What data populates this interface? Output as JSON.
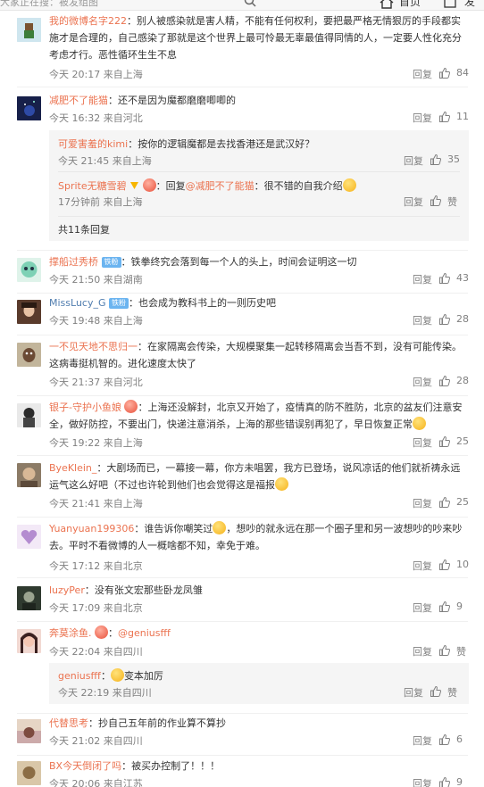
{
  "topbar": {
    "search_placeholder": "大家正在搜：被发组图",
    "home_label": "首页",
    "more_label": "发"
  },
  "reply_label": "回复",
  "comments": [
    {
      "user": "我的微博名字222",
      "text": "：别人被感染就是害人精，不能有任何权利，要把最严格无情狠厉的手段都实施才是合理的，自己感染了那就是这个世界上最可怜最无辜最值得同情的人，一定要人性化充分考虑才行。恶性循环生生不息",
      "time": "今天 20:17 来自上海",
      "likes": "84"
    },
    {
      "user": "减肥不了能猫",
      "text": "：还不是因为魔都磨磨唧唧的",
      "time": "今天 16:32 来自河北",
      "likes": "11",
      "replies": [
        {
          "user": "可爱害羞的kimi",
          "text": "：按你的逻辑魔都是去找香港还是武汉好？",
          "time": "今天 21:45 来自上海",
          "likes": "35"
        },
        {
          "user": "Sprite无糖雪碧",
          "text_prefix": "：回复",
          "mention": "@减肥不了能猫",
          "text": "：很不错的自我介绍",
          "time": "17分钟前 来自上海",
          "likes": "赞"
        }
      ],
      "more_replies": "共11条回复"
    },
    {
      "user": "撑船过秀桥",
      "badge": "铁粉",
      "text": "：铁拳终究会落到每一个人的头上，时间会证明这一切",
      "time": "今天 21:50 来自湖南",
      "likes": "43"
    },
    {
      "user": "MissLucy_G",
      "badge": "铁粉",
      "text": "：也会成为教科书上的一则历史吧",
      "time": "今天 19:48 来自上海",
      "likes": "28"
    },
    {
      "user": "一不见天地不思归一",
      "text": "：在家隔离会传染，大规模聚集一起转移隔离会当吾不到，没有可能传染。这病毒挺机智的。进化速度太快了",
      "time": "今天 21:37 来自河北",
      "likes": "28"
    },
    {
      "user": "银子-守护小鱼娘",
      "text": "：上海还没解封，北京又开始了，疫情真的防不胜防，北京的盆友们注意安全，做好防控，不要出门，快递注意消杀，上海的那些错误别再犯了，早日恢复正常",
      "time": "今天 19:22 来自上海",
      "likes": "25"
    },
    {
      "user": "ByeKlein_",
      "text": "：大剧场而已，一幕接一幕，你方未唱罢，我方已登场，说风凉话的他们就祈祷永远运气这么好吧（不过也许轮到他们也会觉得这是福报",
      "time": "今天 21:41 来自上海",
      "likes": "25"
    },
    {
      "user": "Yuanyuan199306",
      "text_a": "：谁告诉你嘲笑过",
      "text_b": "，想吵的就永远在那一个圈子里和另一波想吵的吵来吵去。平时不看微博的人一概啥都不知，幸免于难。",
      "time": "今天 17:12 来自北京",
      "likes": "10"
    },
    {
      "user": "luzyPer",
      "text": "：没有张文宏那些卧龙凤雏",
      "time": "今天 17:09 来自北京",
      "likes": "9"
    },
    {
      "user": "奔莫涂鱼.",
      "mention": "@geniusfff",
      "text": "：",
      "time": "今天 22:04 来自四川",
      "likes": "赞",
      "replies": [
        {
          "user": "geniusfff",
          "text": "变本加厉",
          "time": "今天 22:19 来自四川",
          "likes": "赞"
        }
      ]
    },
    {
      "user": "代替思考",
      "text": "：抄自己五年前的作业算不算抄",
      "time": "今天 21:02 来自四川",
      "likes": "6"
    },
    {
      "user": "BX今天倒闭了吗",
      "text": "：被买办控制了！！！",
      "time": "今天 20:06 来自江苏",
      "likes": "9"
    }
  ]
}
